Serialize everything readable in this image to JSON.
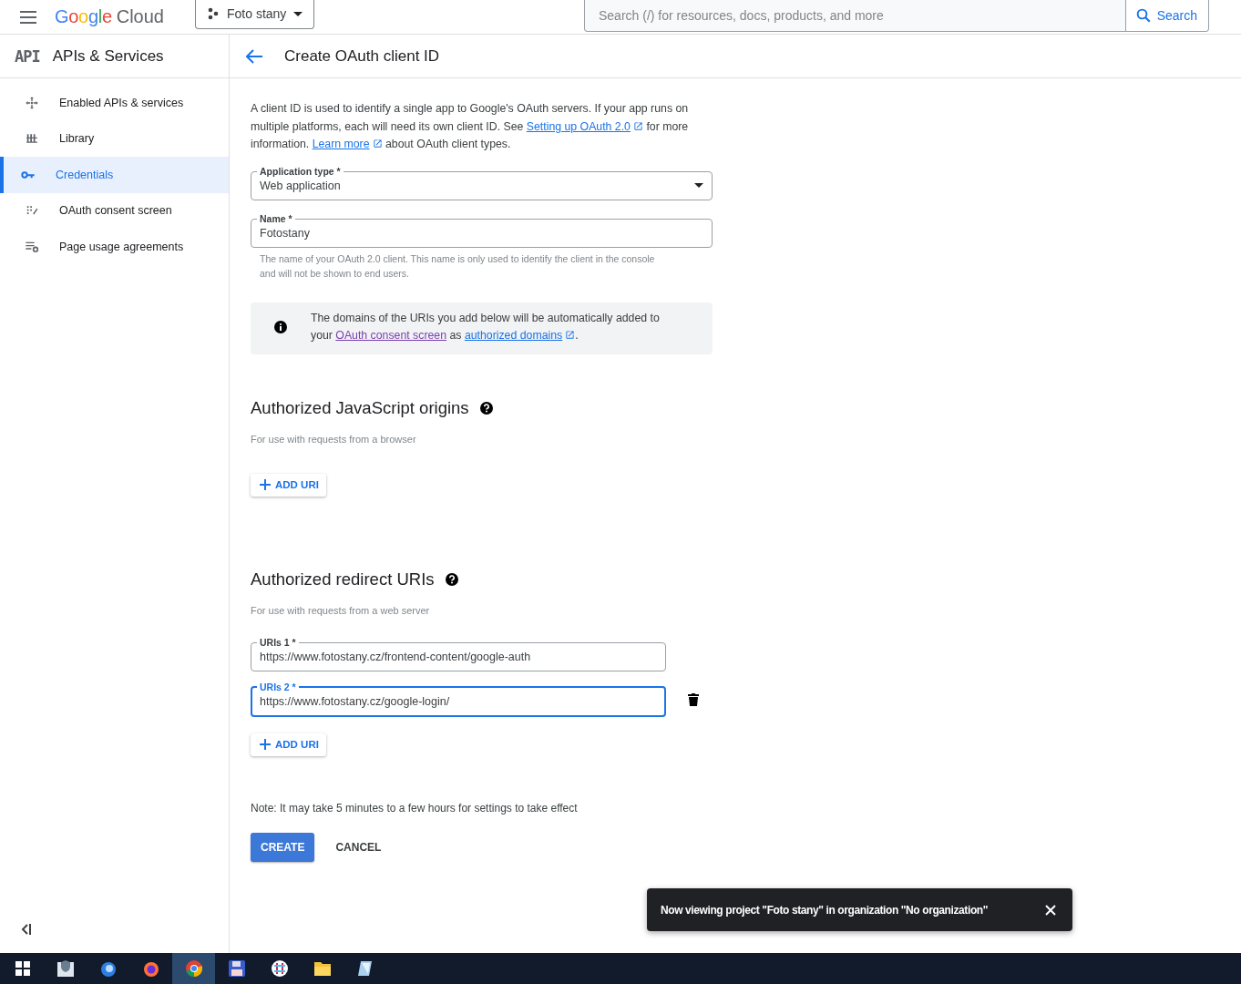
{
  "topbar": {
    "brand_logo": "Google",
    "brand_product": "Cloud",
    "project": "Foto stany",
    "search": {
      "placeholder": "Search (/) for resources, docs, products, and more",
      "button": "Search"
    }
  },
  "sidebar": {
    "logo": "API",
    "title": "APIs & Services",
    "items": [
      {
        "label": "Enabled APIs & services",
        "selected": false
      },
      {
        "label": "Library",
        "selected": false
      },
      {
        "label": "Credentials",
        "selected": true
      },
      {
        "label": "OAuth consent screen",
        "selected": false
      },
      {
        "label": "Page usage agreements",
        "selected": false
      }
    ]
  },
  "page": {
    "title": "Create OAuth client ID",
    "intro": [
      {
        "kind": "text",
        "text": "A client ID is used to identify a single app to Google's OAuth servers. If your app runs on multiple platforms, each will need its own client ID. See"
      },
      {
        "kind": "link",
        "text": "Setting up OAuth 2.0",
        "external": true
      },
      {
        "kind": "text",
        "text": "for more information."
      },
      {
        "kind": "link",
        "text": "Learn more",
        "external": true
      },
      {
        "kind": "text",
        "text": "about OAuth client types."
      }
    ],
    "application_type": {
      "label": "Application type *",
      "value": "Web application"
    },
    "name": {
      "label": "Name *",
      "value": "Fotostany",
      "helper": "The name of your OAuth 2.0 client. This name is only used to identify the client in the console and will not be shown to end users."
    },
    "info": [
      {
        "kind": "text",
        "text": "The domains of the URIs you add below will be automatically added to your"
      },
      {
        "kind": "link",
        "text": "OAuth consent screen",
        "external": false
      },
      {
        "kind": "text",
        "text": "as"
      },
      {
        "kind": "link",
        "text": "authorized domains",
        "external": true
      },
      {
        "kind": "text",
        "text": "."
      }
    ],
    "sections": [
      {
        "title": "Authorized JavaScript origins",
        "subtitle": "For use with requests from a browser",
        "add_button": "ADD URI"
      },
      {
        "title": "Authorized redirect URIs",
        "subtitle": "For use with requests from a web server",
        "uris": [
          {
            "label": "URIs 1 *",
            "value": "https://www.fotostany.cz/frontend-content/google-auth",
            "focused": false,
            "deletable": false
          },
          {
            "label": "URIs 2 *",
            "value": "https://www.fotostany.cz/google-login/",
            "focused": true,
            "deletable": true
          }
        ],
        "add_button": "ADD URI"
      }
    ],
    "note": "Note: It may take 5 minutes to a few hours for settings to take effect",
    "buttons": [
      {
        "label": "CREATE",
        "kind": "primary"
      },
      {
        "label": "CANCEL",
        "kind": "text"
      }
    ]
  },
  "toast": {
    "message": "Now viewing project \"Foto stany\" in organization \"No organization\""
  },
  "taskbar": {
    "apps": [
      {
        "selected": false
      },
      {
        "selected": false
      },
      {
        "selected": false
      },
      {
        "selected": false
      },
      {
        "selected": true
      },
      {
        "selected": false
      },
      {
        "selected": false
      },
      {
        "selected": false
      },
      {
        "selected": false
      }
    ]
  }
}
